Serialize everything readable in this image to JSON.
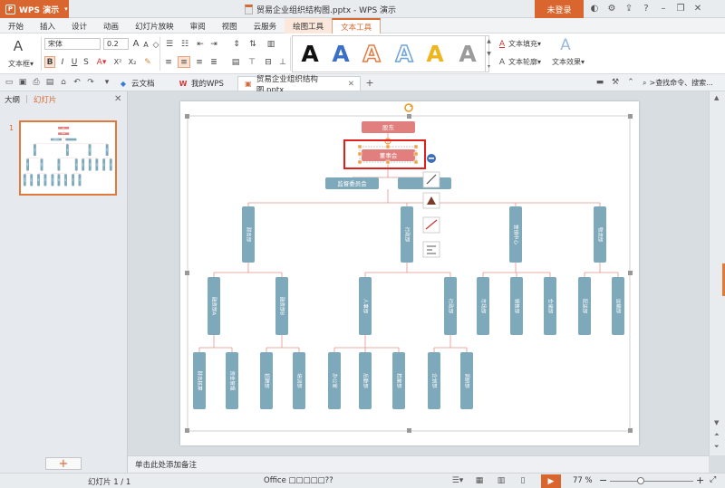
{
  "app": {
    "menu_label": "WPS 演示",
    "doc_title": "贸易企业组织结构图.pptx - WPS 演示",
    "login_label": "未登录"
  },
  "ribbon_tabs": [
    "开始",
    "插入",
    "设计",
    "动画",
    "幻灯片放映",
    "审阅",
    "视图",
    "云服务",
    "绘图工具",
    "文本工具"
  ],
  "ribbon": {
    "textbox_label": "文本框",
    "font_name": "宋体",
    "font_size": "0.2",
    "text_fill_label": "文本填充",
    "text_outline_label": "文本轮廓",
    "text_effect_label": "文本效果",
    "wordart_letter": "A"
  },
  "doc_tabs": {
    "cloud": "云文档",
    "mywps": "我的WPS",
    "current": "贸易企业组织结构图.pptx"
  },
  "search_placeholder": ">查找命令、搜索...",
  "left_panel": {
    "tab_outline": "大纲",
    "tab_slides": "幻灯片",
    "slide_number": "1",
    "add_symbol": "+"
  },
  "notes_placeholder": "单击此处添加备注",
  "status": {
    "slide_indicator": "幻灯片 1 / 1",
    "office_label": "Office □□□□□??",
    "zoom": "77 %"
  },
  "org_chart": {
    "top": "股东",
    "board": "董事会",
    "supervisory": "监督委员会",
    "colors": {
      "top_box": "#e07f7d",
      "node": "#7ea9bb",
      "line": "#e3918a"
    },
    "level1": [
      "财务部",
      "行政部",
      "营销中心",
      "物流部"
    ],
    "level2": [
      "融资部A",
      "融资部B",
      "人事部",
      "行政部",
      "市场部",
      "销售部",
      "仓储部",
      "配送部",
      "运输部"
    ],
    "level3": [
      "财务核算",
      "资金管理",
      "招聘部",
      "培训部",
      "办公室",
      "后勤部",
      "档案部",
      "企划部",
      "调研部"
    ]
  }
}
